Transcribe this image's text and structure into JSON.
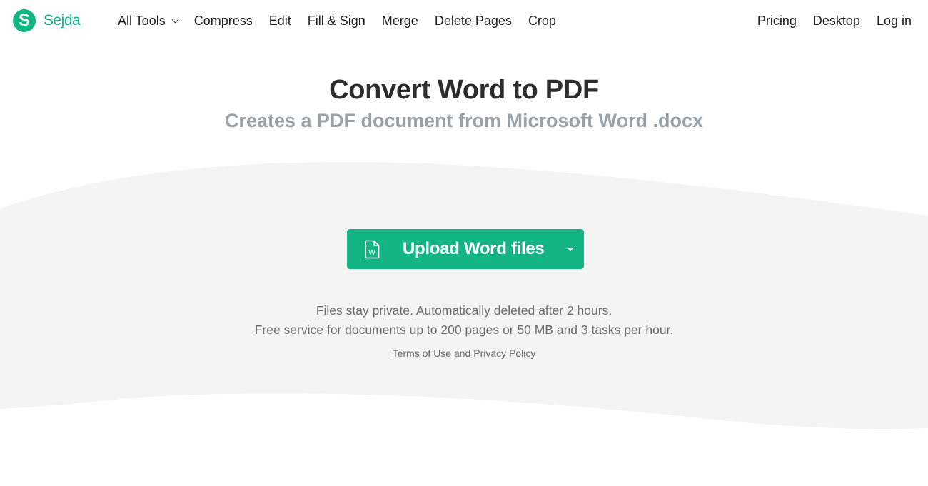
{
  "brand": {
    "logo_letter": "S",
    "name": "Sejda",
    "color": "#14b584"
  },
  "nav": {
    "left": [
      {
        "label": "All Tools",
        "has_dropdown": true
      },
      {
        "label": "Compress"
      },
      {
        "label": "Edit"
      },
      {
        "label": "Fill & Sign"
      },
      {
        "label": "Merge"
      },
      {
        "label": "Delete Pages"
      },
      {
        "label": "Crop"
      }
    ],
    "right": [
      {
        "label": "Pricing"
      },
      {
        "label": "Desktop"
      },
      {
        "label": "Log in"
      }
    ]
  },
  "hero": {
    "title": "Convert Word to PDF",
    "subtitle": "Creates a PDF document from Microsoft Word .docx"
  },
  "upload": {
    "icon": "word-file-icon",
    "icon_letter": "W",
    "label": "Upload Word files",
    "dropdown_icon": "caret-down-icon"
  },
  "info": {
    "line1": "Files stay private. Automatically deleted after 2 hours.",
    "line2": "Free service for documents up to 200 pages or 50 MB and 3 tasks per hour."
  },
  "legal": {
    "terms": "Terms of Use",
    "conjunction": "and",
    "privacy": "Privacy Policy"
  },
  "colors": {
    "accent": "#14b584",
    "band": "#f4f4f4",
    "subtitle": "#99a1a6"
  }
}
